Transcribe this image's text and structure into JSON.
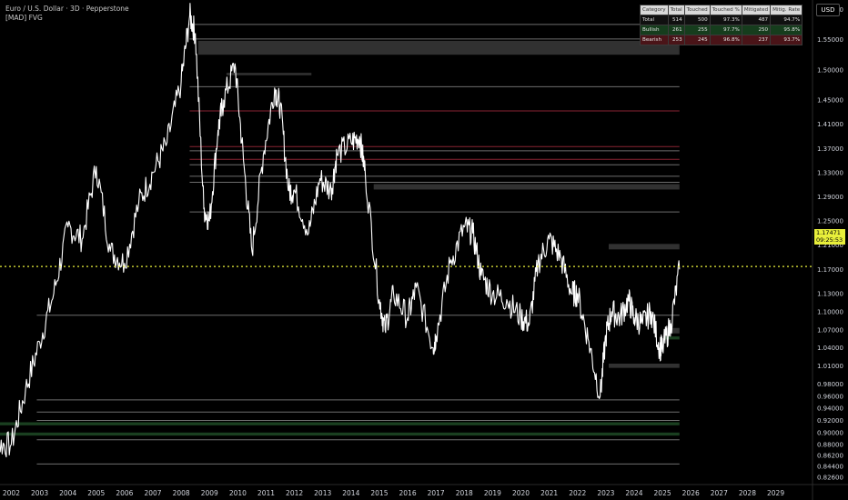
{
  "header": {
    "title": "Euro / U.S. Dollar · 3D · Pepperstone",
    "indicator": "[MAD] FVG"
  },
  "currency_button": "USD",
  "stats_table": {
    "headers": [
      "Category",
      "Total",
      "Touched",
      "Touched %",
      "Mitigated",
      "Mitig. Rate"
    ],
    "rows": [
      [
        "Total",
        "514",
        "500",
        "97.3%",
        "487",
        "94.7%"
      ],
      [
        "Bullish",
        "261",
        "255",
        "97.7%",
        "250",
        "95.8%"
      ],
      [
        "Bearish",
        "253",
        "245",
        "96.8%",
        "237",
        "93.7%"
      ]
    ]
  },
  "current_price": {
    "value": 1.17471,
    "label": "1.17471",
    "countdown": "09:25:53",
    "color": "#e8ef3b"
  },
  "chart_data": {
    "type": "line",
    "series": [
      {
        "color": "#ffffff",
        "x": [
          2001.0,
          2001.5,
          2002.0,
          2002.5,
          2003.0,
          2003.5,
          2004.0,
          2004.5,
          2005.0,
          2005.5,
          2006.0,
          2006.5,
          2007.0,
          2007.5,
          2008.0,
          2008.3,
          2008.5,
          2008.8,
          2009.0,
          2009.3,
          2009.5,
          2009.9,
          2010.2,
          2010.5,
          2010.9,
          2011.3,
          2011.5,
          2011.8,
          2012.0,
          2012.5,
          2012.9,
          2013.3,
          2013.5,
          2014.0,
          2014.3,
          2014.5,
          2015.0,
          2015.2,
          2015.5,
          2016.0,
          2016.3,
          2016.9,
          2017.0,
          2017.5,
          2018.0,
          2018.3,
          2018.6,
          2019.0,
          2019.5,
          2020.0,
          2020.3,
          2020.6,
          2021.0,
          2021.4,
          2021.8,
          2022.0,
          2022.4,
          2022.8,
          2023.0,
          2023.2,
          2023.5,
          2023.8,
          2024.0,
          2024.3,
          2024.6,
          2024.9,
          2025.0,
          2025.3,
          2025.6
        ],
        "y": [
          0.92,
          0.88,
          0.88,
          0.97,
          1.05,
          1.13,
          1.24,
          1.22,
          1.34,
          1.2,
          1.18,
          1.28,
          1.33,
          1.38,
          1.48,
          1.59,
          1.56,
          1.27,
          1.25,
          1.4,
          1.45,
          1.51,
          1.35,
          1.2,
          1.36,
          1.47,
          1.44,
          1.3,
          1.3,
          1.23,
          1.32,
          1.3,
          1.36,
          1.38,
          1.39,
          1.33,
          1.12,
          1.07,
          1.13,
          1.09,
          1.14,
          1.04,
          1.06,
          1.18,
          1.24,
          1.23,
          1.16,
          1.13,
          1.12,
          1.09,
          1.08,
          1.18,
          1.22,
          1.19,
          1.13,
          1.13,
          1.05,
          0.96,
          1.06,
          1.1,
          1.09,
          1.12,
          1.09,
          1.08,
          1.1,
          1.04,
          1.04,
          1.08,
          1.17
        ]
      }
    ],
    "xlim": [
      2001.6,
      2030.3
    ],
    "ylim": [
      0.8155,
      1.6155
    ],
    "x_ticks": [
      2002,
      2003,
      2004,
      2005,
      2006,
      2007,
      2008,
      2009,
      2010,
      2011,
      2012,
      2013,
      2014,
      2015,
      2016,
      2017,
      2018,
      2019,
      2020,
      2021,
      2022,
      2023,
      2024,
      2025,
      2026,
      2027,
      2028,
      2029
    ],
    "y_ticks": [
      "0.82600",
      "0.84400",
      "0.86200",
      "0.88000",
      "0.90000",
      "0.92000",
      "0.94000",
      "0.96000",
      "0.98000",
      "1.01000",
      "1.04000",
      "1.07000",
      "1.10000",
      "1.13000",
      "1.17000",
      "1.21000",
      "1.25000",
      "1.29000",
      "1.33000",
      "1.37000",
      "1.41000",
      "1.45000",
      "1.50000",
      "1.55000",
      "1.60000"
    ],
    "fvg_zones": [
      {
        "type": "bearish",
        "x0": 2008.6,
        "x1": 2025.6,
        "y0": 1.525,
        "y1": 1.548
      },
      {
        "type": "bearish",
        "x0": 2009.6,
        "x1": 2012.6,
        "y0": 1.491,
        "y1": 1.495
      },
      {
        "type": "bearish",
        "x0": 2023.1,
        "x1": 2025.6,
        "y0": 1.203,
        "y1": 1.212
      },
      {
        "type": "bearish",
        "x0": 2014.8,
        "x1": 2025.6,
        "y0": 1.302,
        "y1": 1.311
      },
      {
        "type": "bearish",
        "x0": 2023.1,
        "x1": 2025.6,
        "y0": 1.007,
        "y1": 1.014
      },
      {
        "type": "bearish",
        "x0": 2025.1,
        "x1": 2025.6,
        "y0": 1.064,
        "y1": 1.073
      },
      {
        "type": "bullish",
        "x0": 2025.1,
        "x1": 2025.6,
        "y0": 1.054,
        "y1": 1.059
      },
      {
        "type": "bullish",
        "x0": 2001.6,
        "x1": 2025.6,
        "y0": 0.912,
        "y1": 0.917
      },
      {
        "type": "bullish",
        "x0": 2001.6,
        "x1": 2025.6,
        "y0": 0.895,
        "y1": 0.9
      }
    ],
    "levels": [
      {
        "y": 1.575,
        "color": "#6e6e6e"
      },
      {
        "y": 1.551,
        "color": "#6e6e6e"
      },
      {
        "y": 1.472,
        "color": "#6e6e6e"
      },
      {
        "y": 1.432,
        "color": "#8a2433"
      },
      {
        "y": 1.373,
        "color": "#8a2433"
      },
      {
        "y": 1.366,
        "color": "#6e6e6e"
      },
      {
        "y": 1.352,
        "color": "#8a2433"
      },
      {
        "y": 1.343,
        "color": "#6e6e6e"
      },
      {
        "y": 1.324,
        "color": "#6e6e6e"
      },
      {
        "y": 1.314,
        "color": "#6e6e6e"
      },
      {
        "y": 1.265,
        "color": "#6e6e6e"
      },
      {
        "y": 1.094,
        "color": "#6e6e6e"
      },
      {
        "y": 0.954,
        "color": "#6e6e6e"
      },
      {
        "y": 0.934,
        "color": "#6e6e6e"
      },
      {
        "y": 0.92,
        "color": "#6e6e6e"
      },
      {
        "y": 0.888,
        "color": "#6e6e6e"
      },
      {
        "y": 0.848,
        "color": "#6e6e6e"
      }
    ],
    "colors": {
      "background": "#000000",
      "price_line": "#ffffff",
      "current_price_line": "#e8ef3b",
      "bearish_fvg": "#3a3a3a",
      "bullish_fvg": "#1e4a26",
      "axis_text": "#d1d4dc"
    },
    "grid": false
  }
}
